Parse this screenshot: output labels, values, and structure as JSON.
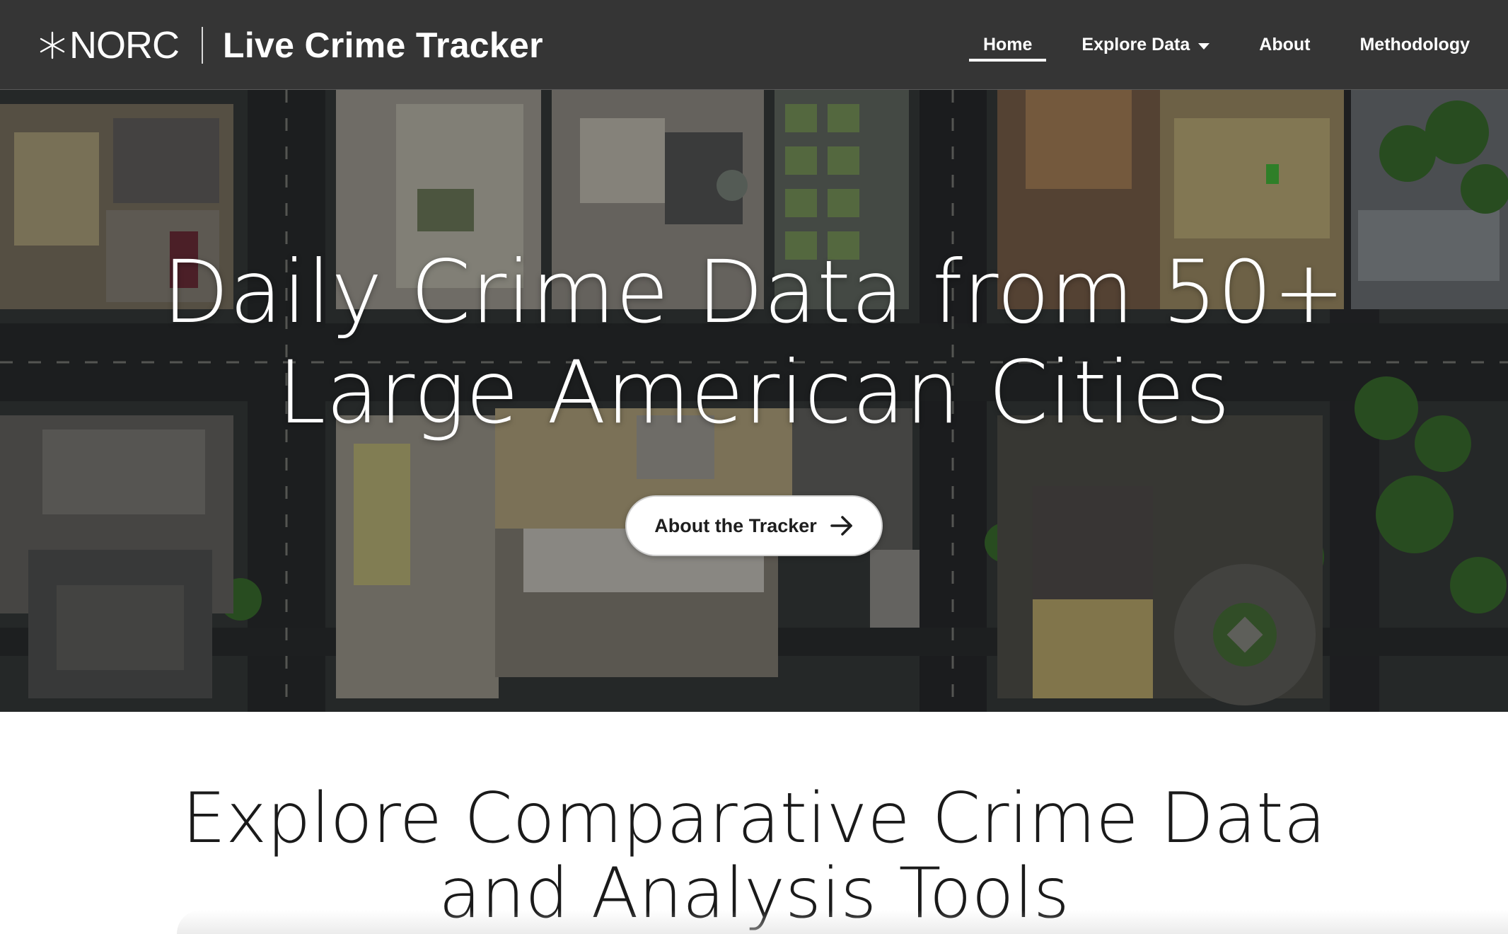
{
  "header": {
    "logo_text": "NORC",
    "site_title": "Live Crime Tracker",
    "nav": [
      {
        "label": "Home",
        "active": true
      },
      {
        "label": "Explore Data",
        "has_dropdown": true
      },
      {
        "label": "About"
      },
      {
        "label": "Methodology"
      }
    ]
  },
  "hero": {
    "headline_line1": "Daily Crime Data from 50+",
    "headline_line2": "Large American Cities",
    "cta_label": "About the Tracker",
    "cta_icon": "arrow-right-icon"
  },
  "explore": {
    "title_line1": "Explore Comparative Crime Data",
    "title_line2": "and Analysis Tools"
  },
  "colors": {
    "header_bg": "#353535",
    "text_light": "#ffffff",
    "text_dark": "#1a1a1a",
    "cta_bg": "#ffffff"
  }
}
